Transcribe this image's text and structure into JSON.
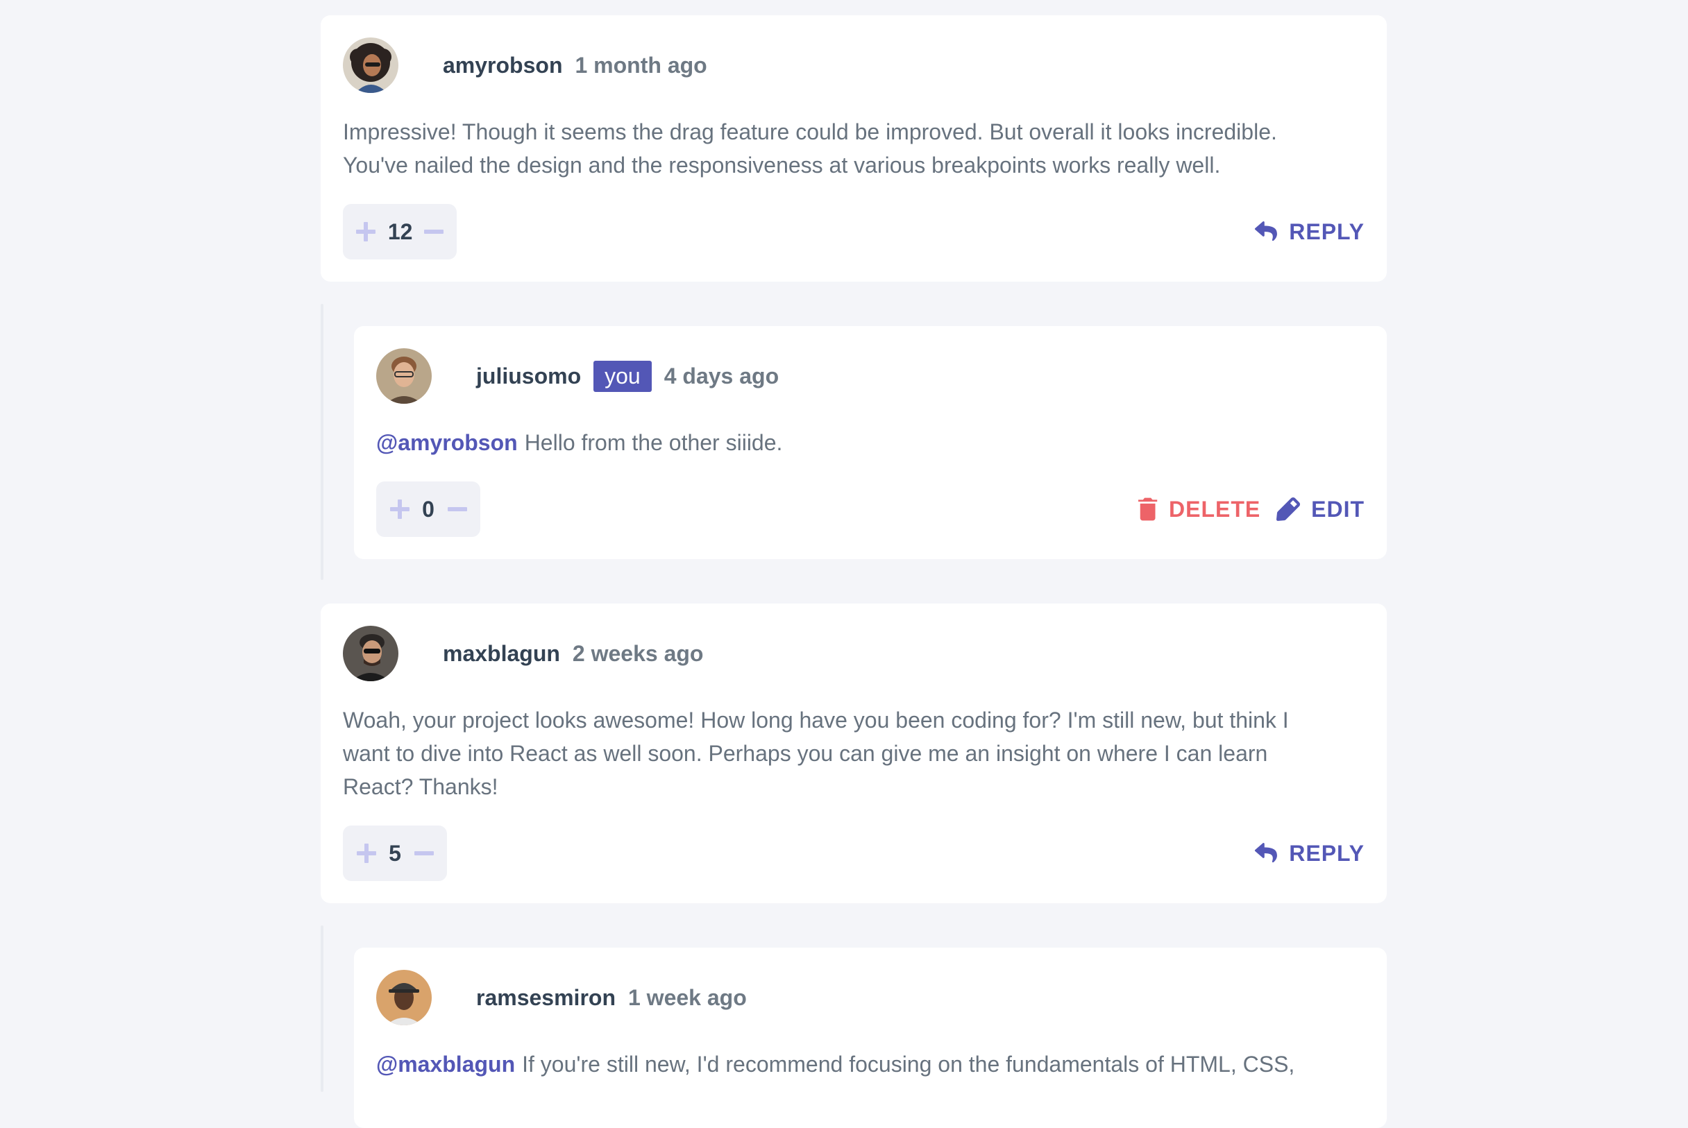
{
  "colors": {
    "background": "#f4f5f9",
    "card": "#ffffff",
    "accent": "#5357b6",
    "danger": "#ed6368",
    "vote_bg": "#f0f1f6",
    "vote_icon": "#c5c6ef"
  },
  "comments": [
    {
      "username": "amyrobson",
      "time": "1 month ago",
      "body": "Impressive! Though it seems the drag feature could be improved. But overall it looks incredible. You've nailed the design and the responsiveness at various breakpoints works really well.",
      "score": "12",
      "action_label": "REPLY",
      "avatar_icon": "avatar-amyrobson",
      "replies": [
        {
          "username": "juliusomo",
          "you_badge": "you",
          "time": "4 days ago",
          "mention": "@amyrobson",
          "body": "Hello from the other siiide.",
          "score": "0",
          "delete_label": "DELETE",
          "edit_label": "EDIT",
          "avatar_icon": "avatar-juliusomo"
        }
      ]
    },
    {
      "username": "maxblagun",
      "time": "2 weeks ago",
      "body": "Woah, your project looks awesome! How long have you been coding for? I'm still new, but think I want to dive into React as well soon. Perhaps you can give me an insight on where I can learn React? Thanks!",
      "score": "5",
      "action_label": "REPLY",
      "avatar_icon": "avatar-maxblagun",
      "replies": [
        {
          "username": "ramsesmiron",
          "time": "1 week ago",
          "mention": "@maxblagun",
          "body": "If you're still new, I'd recommend focusing on the fundamentals of HTML, CSS,",
          "avatar_icon": "avatar-ramsesmiron"
        }
      ]
    }
  ]
}
